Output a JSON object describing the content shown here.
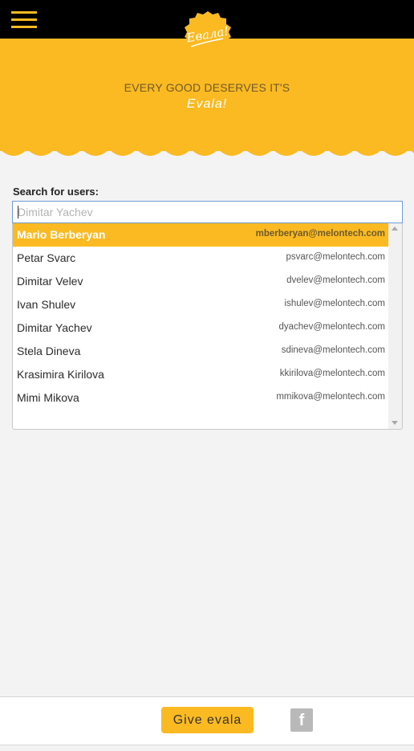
{
  "header": {
    "menu_icon": "hamburger-menu-icon",
    "logo_text": "Евала!",
    "logo_icon": "evala-badge-logo",
    "accent_color": "#fbba22"
  },
  "hero": {
    "line1": "EVERY GOOD DESERVES IT'S",
    "line2": "Evala!"
  },
  "search": {
    "label": "Search for users:",
    "placeholder": "Dimitar Yachev",
    "value": ""
  },
  "users": [
    {
      "name": "Mario Berberyan",
      "email": "mberberyan@melontech.com",
      "selected": true
    },
    {
      "name": "Petar Svarc",
      "email": "psvarc@melontech.com",
      "selected": false
    },
    {
      "name": "Dimitar Velev",
      "email": "dvelev@melontech.com",
      "selected": false
    },
    {
      "name": "Ivan Shulev",
      "email": "ishulev@melontech.com",
      "selected": false
    },
    {
      "name": "Dimitar Yachev",
      "email": "dyachev@melontech.com",
      "selected": false
    },
    {
      "name": "Stela Dineva",
      "email": "sdineva@melontech.com",
      "selected": false
    },
    {
      "name": "Krasimira Kirilova",
      "email": "kkirilova@melontech.com",
      "selected": false
    },
    {
      "name": "Mimi Mikova",
      "email": "mmikova@melontech.com",
      "selected": false
    }
  ],
  "footer": {
    "give_label": "Give evala",
    "facebook_label": "f",
    "facebook_icon": "facebook-icon"
  }
}
